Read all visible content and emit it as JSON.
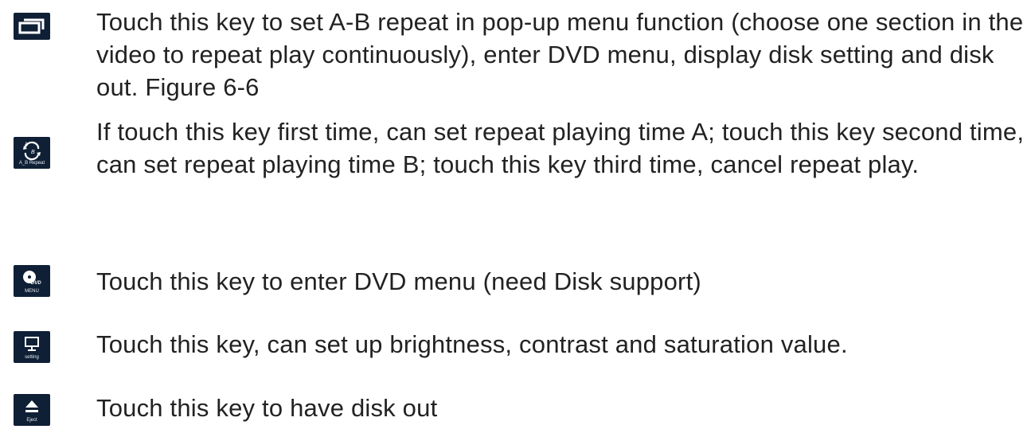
{
  "entries": [
    {
      "icon": "popup-menu-icon",
      "key_label": "",
      "text": "Touch this key to set A-B repeat in pop-up menu function (choose one section in the video to repeat play continuously), enter DVD menu, display disk setting and disk out. Figure 6-6"
    },
    {
      "icon": "ab-repeat-icon",
      "key_label": "A_B Repeat",
      "text": "If touch this key first time, can set repeat playing time A; touch this key second time, can set repeat playing time B; touch this key third time, cancel repeat play."
    },
    {
      "icon": "dvd-menu-icon",
      "key_label": "MENU",
      "text": "Touch this key to enter DVD menu (need Disk support)"
    },
    {
      "icon": "monitor-setting-icon",
      "key_label": "setting",
      "text": "Touch this key, can set up brightness, contrast and saturation value."
    },
    {
      "icon": "eject-icon",
      "key_label": "Eject",
      "text": "Touch this key to have disk out"
    }
  ],
  "colors": {
    "icon_background": "#0f1f35",
    "text": "#222222"
  }
}
